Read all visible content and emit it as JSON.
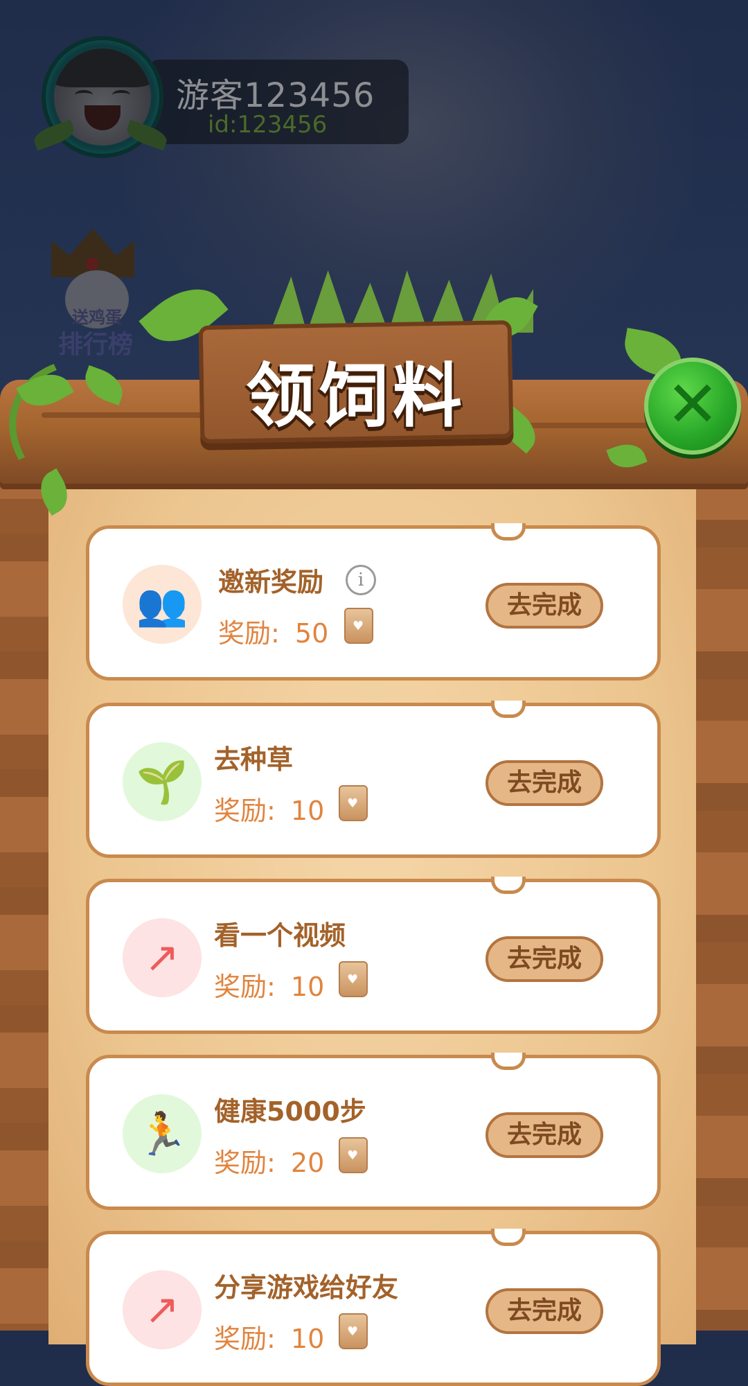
{
  "player": {
    "name": "游客123456",
    "id": "id:123456"
  },
  "rank_badge": {
    "top_text": "送鸡蛋",
    "label": "排行榜"
  },
  "modal": {
    "title": "领饲料",
    "close_icon": "close-x-icon"
  },
  "tasks": [
    {
      "title": "邀新奖励",
      "reward_label": "奖励:",
      "reward_value": "50",
      "button": "去完成",
      "icon": "users-icon",
      "has_info": true
    },
    {
      "title": "去种草",
      "reward_label": "奖励:",
      "reward_value": "10",
      "button": "去完成",
      "icon": "sprout-icon"
    },
    {
      "title": "看一个视频",
      "reward_label": "奖励:",
      "reward_value": "10",
      "button": "去完成",
      "icon": "share-icon"
    },
    {
      "title": "健康5000步",
      "reward_label": "奖励:",
      "reward_value": "20",
      "button": "去完成",
      "icon": "running-icon"
    },
    {
      "title": "分享游戏给好友",
      "reward_label": "奖励:",
      "reward_value": "10",
      "button": "去完成",
      "icon": "share-icon"
    }
  ],
  "colors": {
    "wood": "#a86a3c",
    "parchment": "#f5d6a8",
    "button_fill": "#e5b786",
    "title_text": "#a3622a",
    "reward_text": "#e0843f",
    "close_green": "#27a628"
  }
}
